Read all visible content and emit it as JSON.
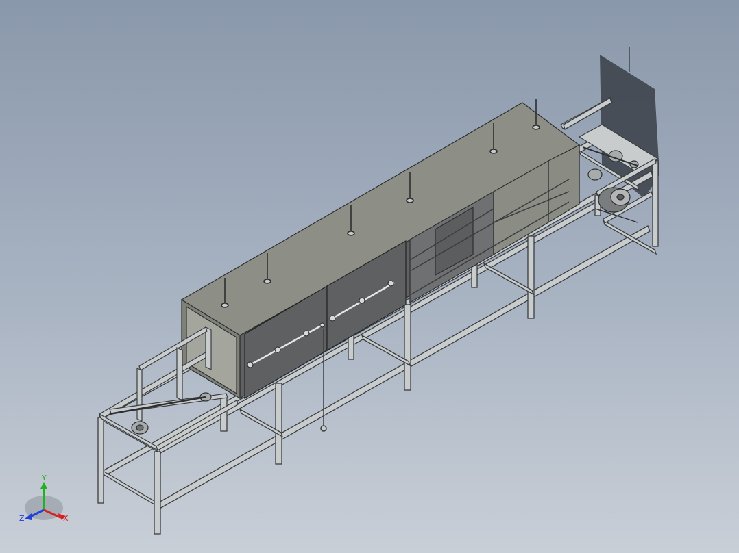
{
  "viewport": {
    "background_top": "#8a98ab",
    "background_bottom": "#c9cfd7",
    "model": "conveyor-tunnel-oven-assembly"
  },
  "triad": {
    "x_label": "X",
    "y_label": "Y",
    "z_label": "Z",
    "x_color": "#d92020",
    "y_color": "#1fb31f",
    "z_color": "#2040d9"
  },
  "colors": {
    "frame_edge": "#3a3d40",
    "oven_top": "#8d8f86",
    "oven_front": "#5f6163",
    "oven_side": "#7f8179",
    "shadow": "#2e3238"
  }
}
